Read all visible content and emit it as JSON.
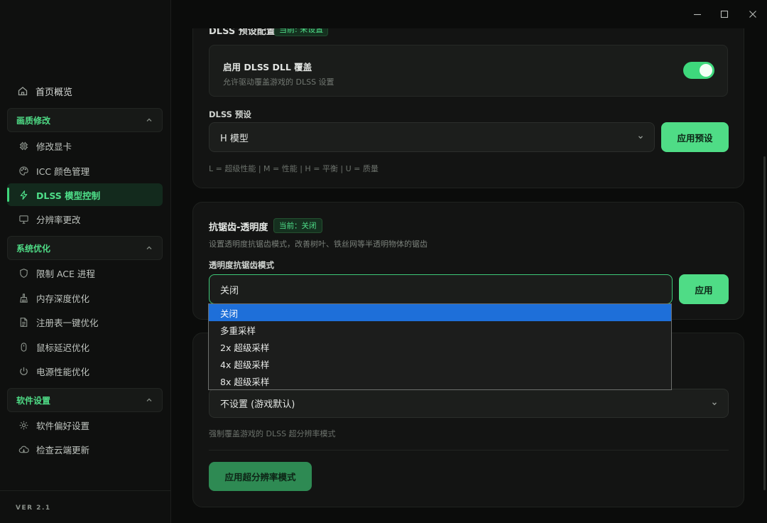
{
  "window": {
    "controls": [
      "minimize-icon",
      "maximize-icon",
      "close-icon"
    ]
  },
  "sidebar": {
    "brand": "",
    "home_label": "首页概览",
    "groups": [
      {
        "title": "画质修改",
        "items": [
          {
            "label": "修改显卡",
            "icon": "chip-icon"
          },
          {
            "label": "ICC 颜色管理",
            "icon": "palette-icon"
          },
          {
            "label": "DLSS 模型控制",
            "icon": "lightning-icon",
            "active": true
          },
          {
            "label": "分辨率更改",
            "icon": "monitor-icon"
          }
        ]
      },
      {
        "title": "系统优化",
        "items": [
          {
            "label": "限制 ACE 进程",
            "icon": "shield-icon"
          },
          {
            "label": "内存深度优化",
            "icon": "broom-icon"
          },
          {
            "label": "注册表一键优化",
            "icon": "file-icon"
          },
          {
            "label": "鼠标延迟优化",
            "icon": "mouse-icon"
          },
          {
            "label": "电源性能优化",
            "icon": "power-icon"
          }
        ]
      },
      {
        "title": "软件设置",
        "items": [
          {
            "label": "软件偏好设置",
            "icon": "gear-icon"
          },
          {
            "label": "检查云端更新",
            "icon": "cloud-icon"
          }
        ]
      }
    ],
    "version": "VER 2.1"
  },
  "dlss_card": {
    "title": "DLSS 预设配置",
    "badge": "当前: 未设置",
    "toggle_title": "启用 DLSS DLL 覆盖",
    "toggle_desc": "允许驱动覆盖游戏的 DLSS 设置",
    "toggle_on": true,
    "preset_label": "DLSS 预设",
    "preset_value": "H 模型",
    "apply_preset": "应用预设",
    "preset_hint": "L = 超级性能 | M = 性能 | H = 平衡 | U = 质量"
  },
  "aa_card": {
    "title": "抗锯齿-透明度",
    "badge": "当前：关闭",
    "desc": "设置透明度抗锯齿模式，改善树叶、铁丝网等半透明物体的锯齿",
    "mode_label": "透明度抗锯齿模式",
    "mode_value": "关闭",
    "apply": "应用",
    "options": [
      "关闭",
      "多重采样",
      "2x 超级采样",
      "4x 超级采样",
      "8x 超级采样"
    ],
    "selected_index": 0
  },
  "sr_card": {
    "select_value": "不设置 (游戏默认)",
    "hint": "强制覆盖游戏的 DLSS 超分辨率模式",
    "apply": "应用超分辨率模式"
  },
  "colors": {
    "accent": "#4fdc86",
    "selected_option": "#1e6fd9"
  }
}
